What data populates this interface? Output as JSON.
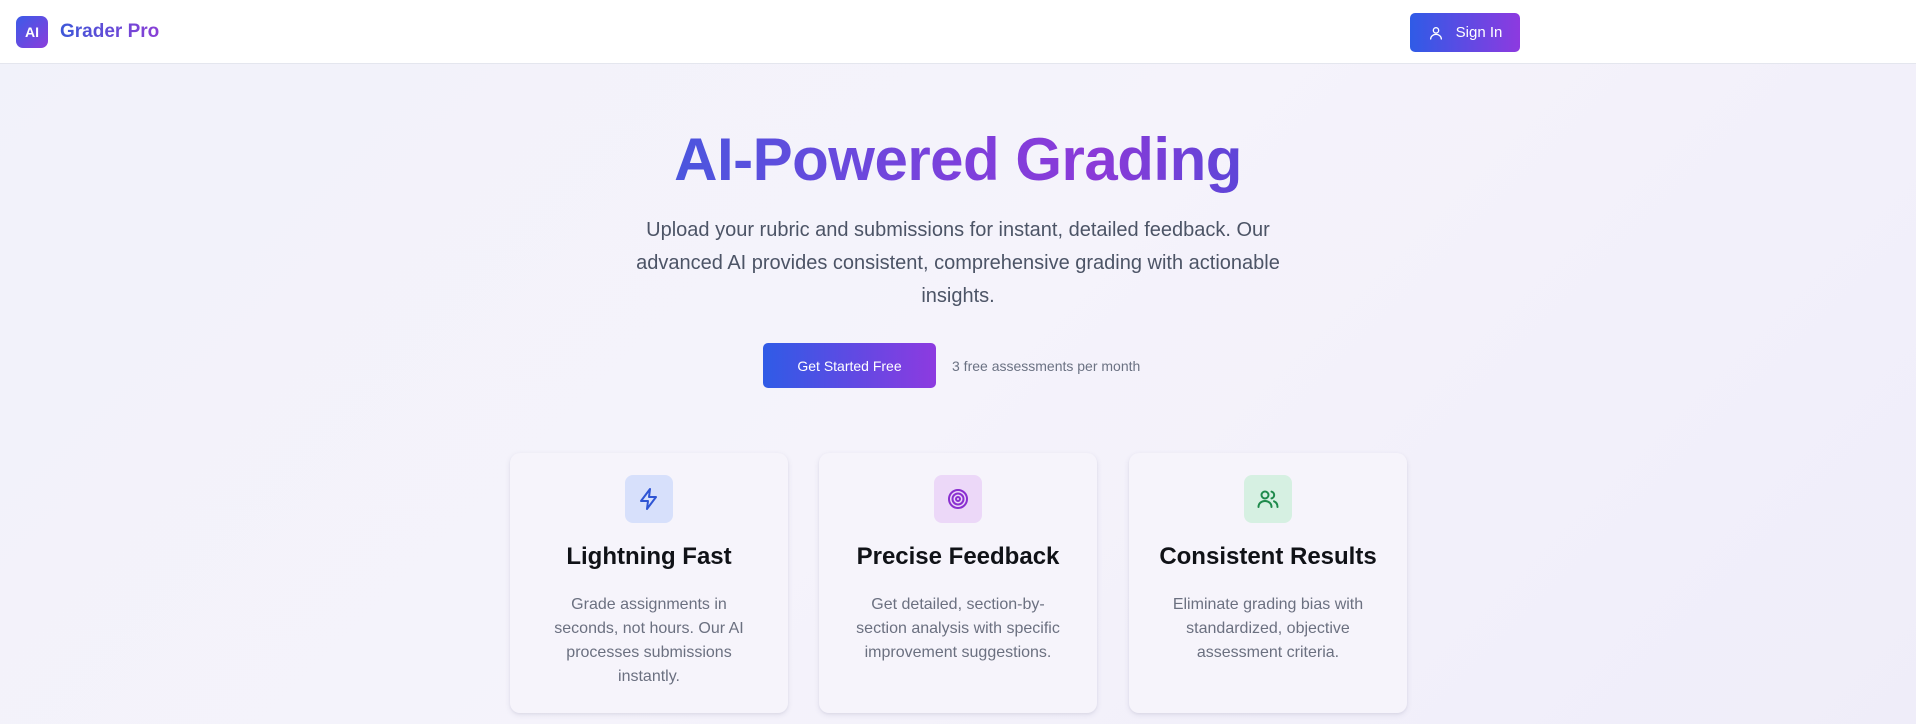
{
  "header": {
    "logo_text": "AI",
    "brand_name": "Grader Pro",
    "signin_label": "Sign In",
    "signin_icon": "user-icon"
  },
  "hero": {
    "title": "AI-Powered Grading",
    "subtitle": "Upload your rubric and submissions for instant, detailed feedback. Our advanced AI provides consistent, comprehensive grading with actionable insights.",
    "cta_label": "Get Started Free",
    "cta_note": "3 free assessments per month"
  },
  "features": [
    {
      "icon": "lightning-icon",
      "title": "Lightning Fast",
      "text": "Grade assignments in seconds, not hours. Our AI processes submissions instantly."
    },
    {
      "icon": "target-icon",
      "title": "Precise Feedback",
      "text": "Get detailed, section-by-section analysis with specific improvement suggestions."
    },
    {
      "icon": "users-icon",
      "title": "Consistent Results",
      "text": "Eliminate grading bias with standardized, objective assessment criteria."
    }
  ],
  "colors": {
    "accent_start": "#2f5be6",
    "accent_end": "#8d3ae0"
  }
}
